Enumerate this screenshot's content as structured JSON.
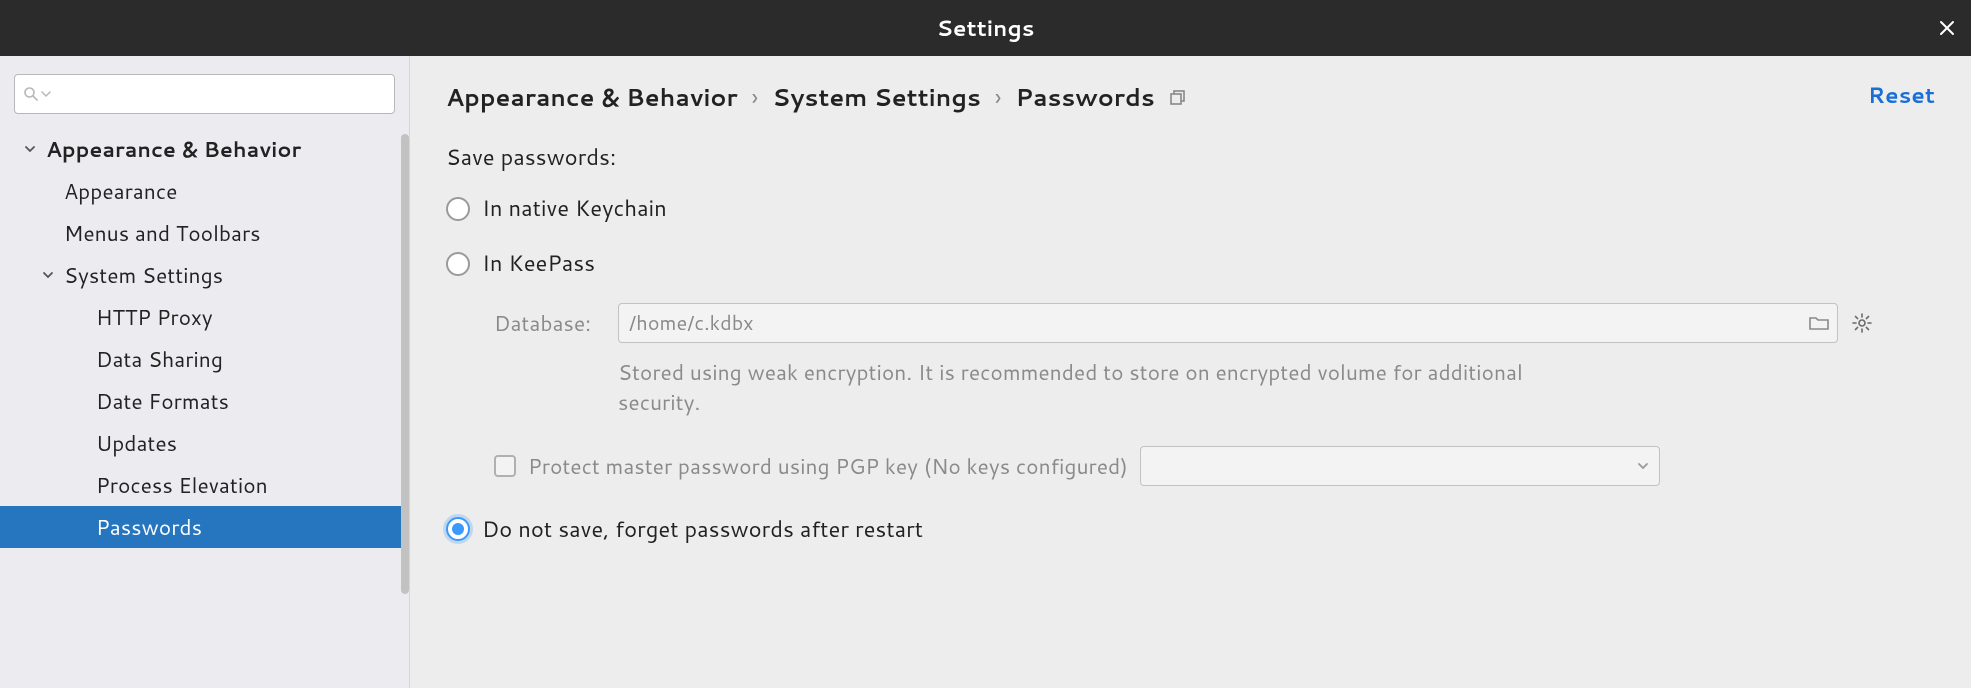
{
  "title": "Settings",
  "reset_label": "Reset",
  "breadcrumb": [
    "Appearance & Behavior",
    "System Settings",
    "Passwords"
  ],
  "sidebar": {
    "search_placeholder": "",
    "items": [
      {
        "label": "Appearance & Behavior",
        "level": 0,
        "bold": true,
        "expanded": true
      },
      {
        "label": "Appearance",
        "level": 1
      },
      {
        "label": "Menus and Toolbars",
        "level": 1
      },
      {
        "label": "System Settings",
        "level": 1,
        "expanded": true,
        "has_caret": true
      },
      {
        "label": "HTTP Proxy",
        "level": 2
      },
      {
        "label": "Data Sharing",
        "level": 2
      },
      {
        "label": "Date Formats",
        "level": 2
      },
      {
        "label": "Updates",
        "level": 2
      },
      {
        "label": "Process Elevation",
        "level": 2
      },
      {
        "label": "Passwords",
        "level": 2,
        "selected": true
      }
    ]
  },
  "passwords": {
    "section_label": "Save passwords:",
    "options": {
      "native": "In native Keychain",
      "keepass": "In KeePass",
      "none": "Do not save, forget passwords after restart"
    },
    "selected": "none",
    "keepass": {
      "db_label": "Database:",
      "db_value": "/home/c.kdbx",
      "hint": "Stored using weak encryption. It is recommended to store on encrypted volume for additional security.",
      "protect_label": "Protect master password using PGP key (No keys configured)"
    }
  }
}
